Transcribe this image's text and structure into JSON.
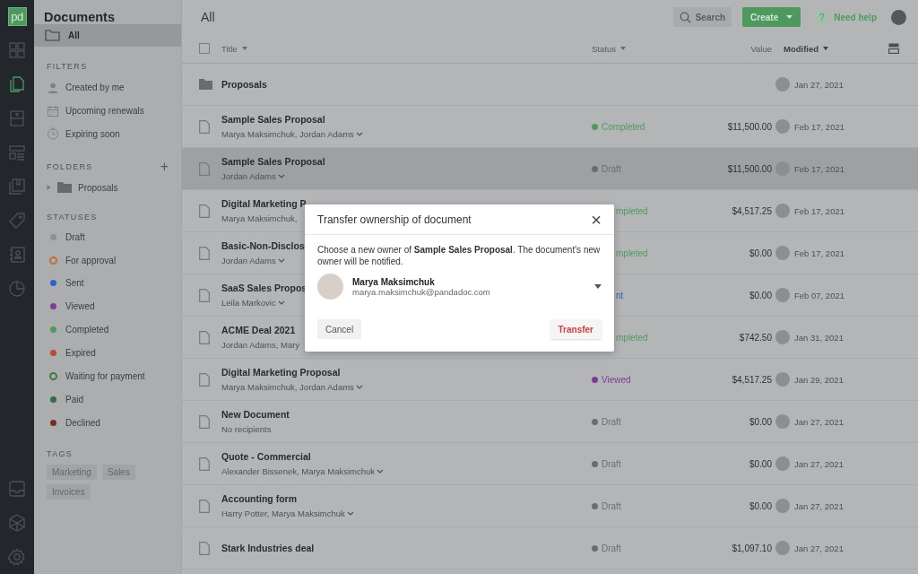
{
  "nav": {
    "logo": "pd",
    "items": [
      {
        "selected": false
      },
      {
        "selected": true
      },
      {
        "selected": false
      },
      {
        "selected": false
      },
      {
        "selected": false
      },
      {
        "selected": false
      },
      {
        "selected": false
      },
      {
        "selected": false
      }
    ],
    "bottom_items": [
      {
        "selected": false
      },
      {
        "selected": false
      },
      {
        "selected": false
      }
    ]
  },
  "panel": {
    "title": "Documents",
    "all_item": {
      "label": "All",
      "selected": true
    },
    "filters": {
      "heading": "FILTERS",
      "items": [
        "Created by me",
        "Upcoming renewals",
        "Expiring soon"
      ]
    },
    "folders": {
      "heading": "FOLDERS",
      "add": "+",
      "items": [
        {
          "label": "Proposals",
          "expanded": false
        }
      ]
    },
    "statuses": {
      "heading": "STATUSES",
      "items": [
        {
          "label": "Draft",
          "color": "#8f9092",
          "kind": "dot"
        },
        {
          "label": "For approval",
          "color": "#c46f3a",
          "kind": "ring"
        },
        {
          "label": "Sent",
          "color": "#2f62c6",
          "kind": "dot"
        },
        {
          "label": "Viewed",
          "color": "#7b3e97",
          "kind": "dot"
        },
        {
          "label": "Completed",
          "color": "#4e9a5e",
          "kind": "dot"
        },
        {
          "label": "Expired",
          "color": "#b8493b",
          "kind": "dot"
        },
        {
          "label": "Waiting for payment",
          "color": "#3e7a49",
          "kind": "ring"
        },
        {
          "label": "Paid",
          "color": "#2f6e3f",
          "kind": "dot"
        },
        {
          "label": "Declined",
          "color": "#7b2b27",
          "kind": "dot"
        }
      ]
    },
    "tags": {
      "heading": "TAGS",
      "items": [
        "Marketing",
        "Sales",
        "Invoices"
      ]
    }
  },
  "topbar": {
    "title": "All",
    "search": "Search",
    "create": "Create",
    "help_icon": "?",
    "help": "Need help"
  },
  "table": {
    "columns": [
      {
        "label": "Title",
        "sorted": false,
        "menu": true
      },
      {
        "label": "Status",
        "sorted": false,
        "menu": true
      },
      {
        "label": "Value",
        "sorted": false,
        "menu": false
      },
      {
        "label": "Modified",
        "sorted": true,
        "menu": true
      }
    ],
    "select_all": {
      "checked": false
    },
    "rows": [
      {
        "kind": "folder",
        "title": "Proposals",
        "selected": false,
        "modified": "Jan 27, 2021"
      },
      {
        "kind": "document",
        "title": "Sample Sales Proposal",
        "recipients": "Marya Maksimchuk, Jordan Adams",
        "recipients_menu": true,
        "status": {
          "label": "Completed",
          "color": "#4e9a5e"
        },
        "value": "$11,500.00",
        "modified": "Feb 17, 2021",
        "selected": false
      },
      {
        "kind": "document",
        "title": "Sample Sales Proposal",
        "recipients": "Jordan Adams",
        "recipients_menu": true,
        "status": {
          "label": "Draft",
          "color": "#6b6c6e"
        },
        "value": "$11,500.00",
        "modified": "Feb 17, 2021",
        "selected": true
      },
      {
        "kind": "document",
        "title": "Digital Marketing P",
        "recipients": "Marya Maksimchuk,",
        "recipients_menu": false,
        "status": {
          "label": "mpleted",
          "color": "#4e9a5e"
        },
        "value": "$4,517.25",
        "modified": "Feb 17, 2021",
        "selected": false
      },
      {
        "kind": "document",
        "title": "Basic-Non-Disclos",
        "recipients": "Jordan Adams",
        "recipients_menu": true,
        "status": {
          "label": "mpleted",
          "color": "#4e9a5e"
        },
        "value": "$0.00",
        "modified": "Feb 17, 2021",
        "selected": false
      },
      {
        "kind": "document",
        "title": "SaaS Sales Propos",
        "recipients": "Leila Markovic",
        "recipients_menu": true,
        "status": {
          "label": "nt",
          "color": "#2f62c6"
        },
        "value": "$0.00",
        "modified": "Feb 07, 2021",
        "selected": false
      },
      {
        "kind": "document",
        "title": "ACME Deal 2021",
        "recipients": "Jordan Adams, Mary",
        "recipients_menu": false,
        "status": {
          "label": "mpleted",
          "color": "#4e9a5e"
        },
        "value": "$742.50",
        "modified": "Jan 31, 2021",
        "selected": false
      },
      {
        "kind": "document",
        "title": "Digital Marketing Proposal",
        "recipients": "Marya Maksimchuk, Jordan Adams",
        "recipients_menu": true,
        "status": {
          "label": "Viewed",
          "color": "#7b3e97"
        },
        "value": "$4,517.25",
        "modified": "Jan 29, 2021",
        "selected": false
      },
      {
        "kind": "document",
        "title": "New Document",
        "recipients": "No recipients",
        "recipients_menu": false,
        "status": {
          "label": "Draft",
          "color": "#6b6c6e"
        },
        "value": "$0.00",
        "modified": "Jan 27, 2021",
        "selected": false
      },
      {
        "kind": "document",
        "title": "Quote - Commercial",
        "recipients": "Alexander Bissenek, Marya Maksimchuk",
        "recipients_menu": true,
        "status": {
          "label": "Draft",
          "color": "#6b6c6e"
        },
        "value": "$0.00",
        "modified": "Jan 27, 2021",
        "selected": false
      },
      {
        "kind": "document",
        "title": "Accounting form",
        "recipients": "Harry Potter, Marya Maksimchuk",
        "recipients_menu": true,
        "status": {
          "label": "Draft",
          "color": "#6b6c6e"
        },
        "value": "$0.00",
        "modified": "Jan 27, 2021",
        "selected": false
      },
      {
        "kind": "document",
        "title": "Stark Industries deal",
        "status": {
          "label": "Draft",
          "color": "#6b6c6e"
        },
        "value": "$1,097.10",
        "modified": "Jan 27, 2021",
        "selected": false
      }
    ]
  },
  "dialog": {
    "title": "Transfer ownership of document",
    "close": "×",
    "message": "Choose a new owner of **Sample Sales Proposal**. The document's new owner will be notified.",
    "owner": {
      "name": "Marya Maksimchuk",
      "email": "marya.maksimchuk@pandadoc.com"
    },
    "cancel": "Cancel",
    "confirm": "Transfer"
  }
}
